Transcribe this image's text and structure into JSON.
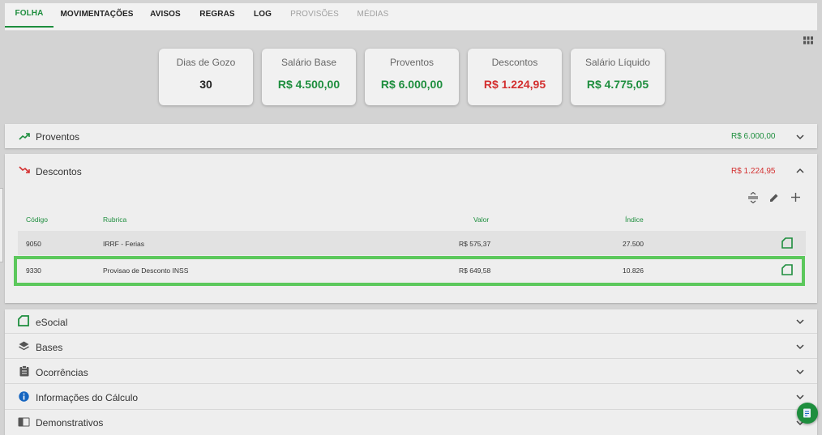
{
  "tabs": [
    {
      "label": "FOLHA",
      "state": "active"
    },
    {
      "label": "MOVIMENTAÇÕES",
      "state": "normal"
    },
    {
      "label": "AVISOS",
      "state": "normal"
    },
    {
      "label": "REGRAS",
      "state": "normal"
    },
    {
      "label": "LOG",
      "state": "normal"
    },
    {
      "label": "PROVISÕES",
      "state": "disabled"
    },
    {
      "label": "MÉDIAS",
      "state": "disabled"
    }
  ],
  "summary": [
    {
      "label": "Dias de Gozo",
      "value": "30",
      "color": "#222222"
    },
    {
      "label": "Salário Base",
      "value": "R$ 4.500,00",
      "color": "#1e8e3e"
    },
    {
      "label": "Proventos",
      "value": "R$ 6.000,00",
      "color": "#1e8e3e"
    },
    {
      "label": "Descontos",
      "value": "R$ 1.224,95",
      "color": "#d32f2f"
    },
    {
      "label": "Salário Líquido",
      "value": "R$ 4.775,05",
      "color": "#1e8e3e"
    }
  ],
  "proventos": {
    "title": "Proventos",
    "amount": "R$ 6.000,00",
    "icon": "trending-up-icon"
  },
  "descontos": {
    "title": "Descontos",
    "amount": "R$ 1.224,95",
    "icon": "trending-down-icon",
    "columns": {
      "codigo": "Código",
      "rubrica": "Rubrica",
      "valor": "Valor",
      "indice": "Índice"
    },
    "rows": [
      {
        "codigo": "9050",
        "rubrica": "IRRF - Ferias",
        "valor": "R$ 575,37",
        "indice": "27.500"
      },
      {
        "codigo": "9330",
        "rubrica": "Provisao de Desconto INSS",
        "valor": "R$ 649,58",
        "indice": "10.826"
      }
    ]
  },
  "sections": [
    {
      "title": "eSocial",
      "icon": "esocial-icon"
    },
    {
      "title": "Bases",
      "icon": "layers-icon"
    },
    {
      "title": "Ocorrências",
      "icon": "clipboard-icon"
    },
    {
      "title": "Informações do Cálculo",
      "icon": "info-icon"
    },
    {
      "title": "Demonstrativos",
      "icon": "book-icon"
    }
  ],
  "colors": {
    "accent": "#1e8e3e",
    "negative": "#d32f2f",
    "highlight": "#5cc85c"
  }
}
